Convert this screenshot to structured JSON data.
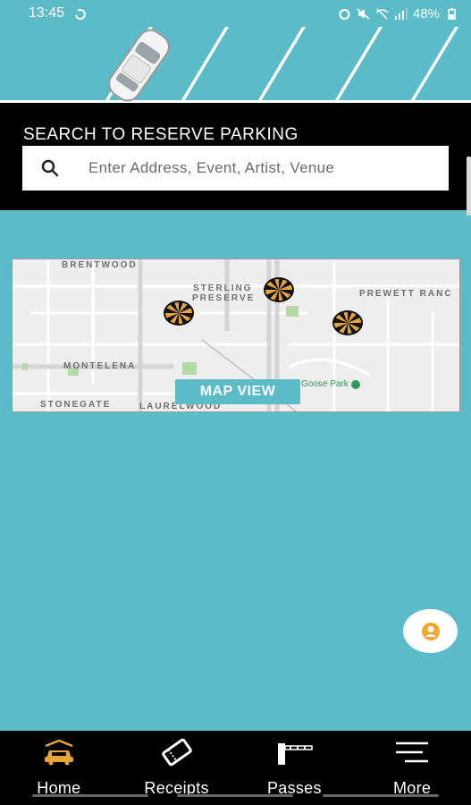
{
  "status_bar": {
    "time": "13:45",
    "battery": "48%"
  },
  "search": {
    "title": "SEARCH TO RESERVE PARKING",
    "placeholder": "Enter Address, Event, Artist, Venue"
  },
  "map": {
    "labels": [
      "BRENTWOOD",
      "STERLING",
      "PRESERVE",
      "PREWETT RANC",
      "MONTELENA",
      "STONEGATE",
      "LAURELWOOD"
    ],
    "poi": "Goose Park",
    "map_view_label": "MAP VIEW"
  },
  "nav": {
    "items": [
      {
        "label": "Home",
        "icon": "car-icon"
      },
      {
        "label": "Receipts",
        "icon": "ticket-icon"
      },
      {
        "label": "Passes",
        "icon": "barrier-icon"
      },
      {
        "label": "More",
        "icon": "menu-icon"
      }
    ]
  },
  "colors": {
    "background": "#5bbcc8",
    "band": "#000000",
    "active_nav": "#e6a53a",
    "pin": "#e6a53a"
  }
}
